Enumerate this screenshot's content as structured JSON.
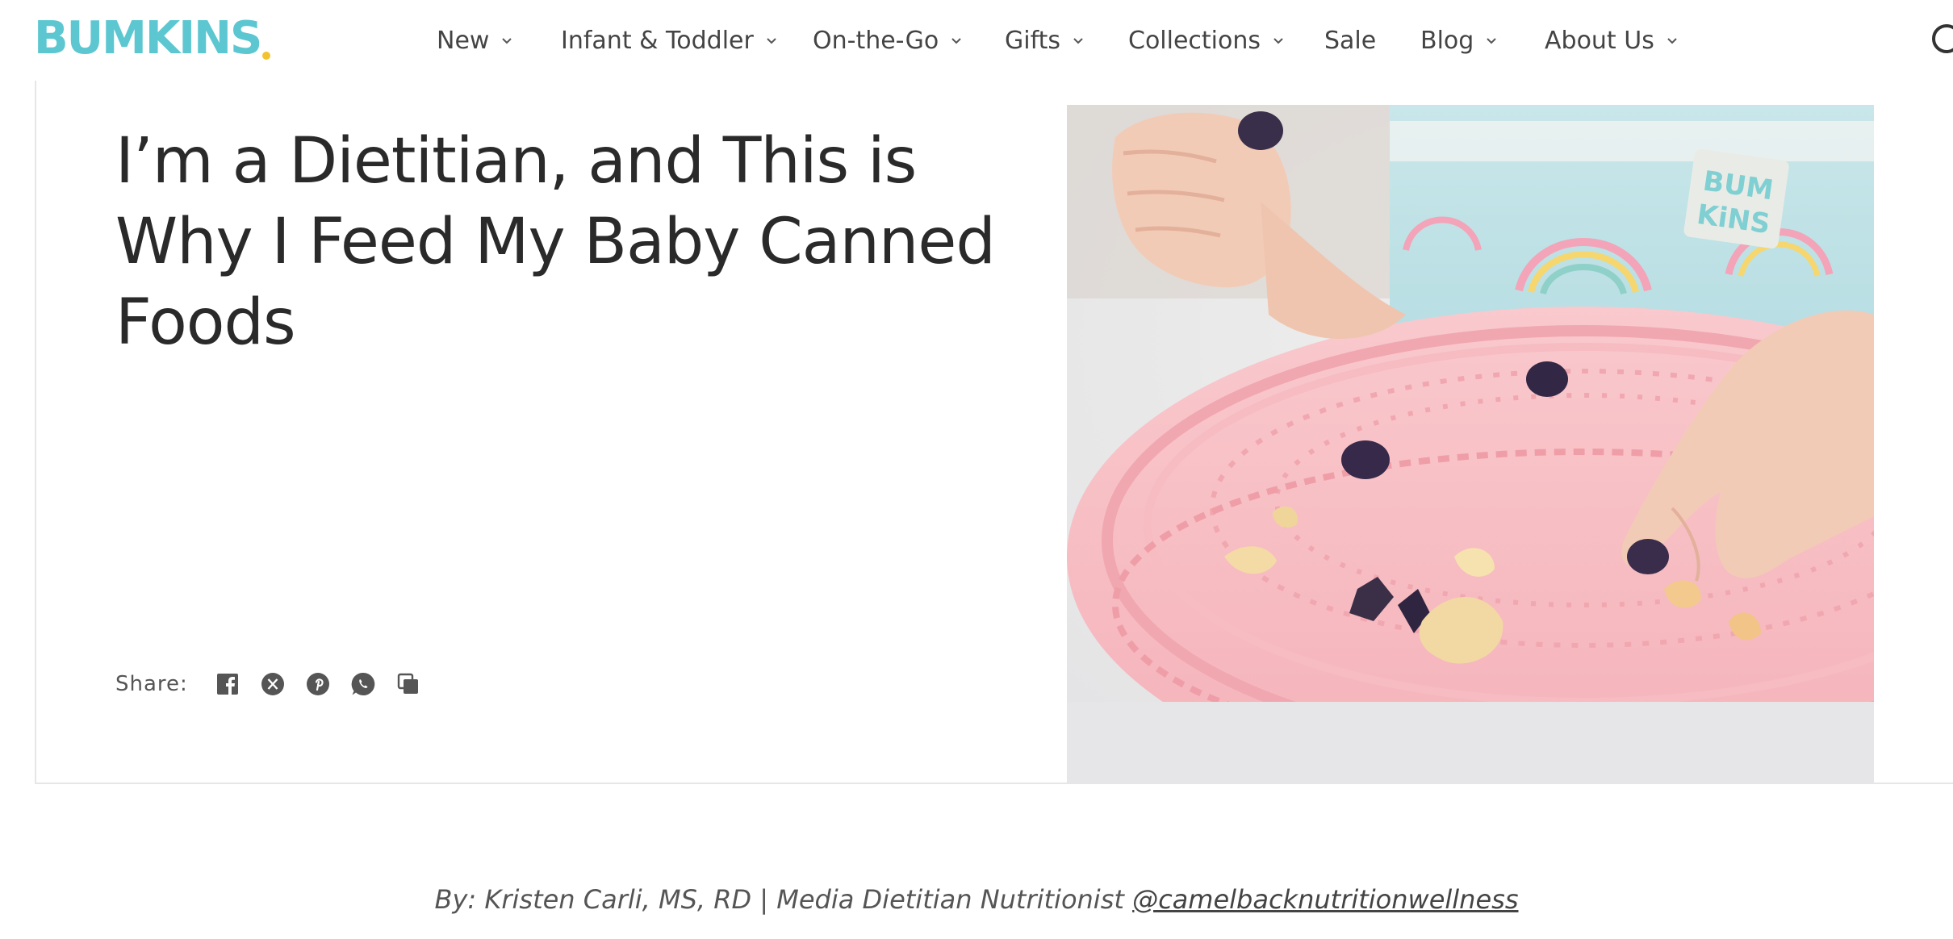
{
  "brand": {
    "logo_text": "BUMKINS"
  },
  "nav": {
    "items": [
      {
        "label": "New",
        "has_dropdown": true
      },
      {
        "label": "Infant & Toddler",
        "has_dropdown": true
      },
      {
        "label": "On-the-Go",
        "has_dropdown": true
      },
      {
        "label": "Gifts",
        "has_dropdown": true
      },
      {
        "label": "Collections",
        "has_dropdown": true
      },
      {
        "label": "Sale",
        "has_dropdown": false
      },
      {
        "label": "Blog",
        "has_dropdown": true
      },
      {
        "label": "About Us",
        "has_dropdown": true
      }
    ]
  },
  "article": {
    "title": "I’m a Dietitian, and This is Why I Feed My Baby Canned Foods",
    "share_label": "Share:",
    "share_buttons": [
      "facebook-icon",
      "x-icon",
      "pinterest-icon",
      "whatsapp-icon",
      "copy-link-icon"
    ],
    "image_badge": {
      "line1": "BUM",
      "line2": "KiNS"
    },
    "byline_text": "By: Kristen Carli, MS, RD | Media Dietitian Nutritionist ",
    "byline_handle": "@camelbacknutritionwellness"
  },
  "colors": {
    "brand": "#5cc7d1",
    "brand_dot": "#f2c230",
    "text": "#2a2a2a",
    "nav_text": "#444444"
  }
}
